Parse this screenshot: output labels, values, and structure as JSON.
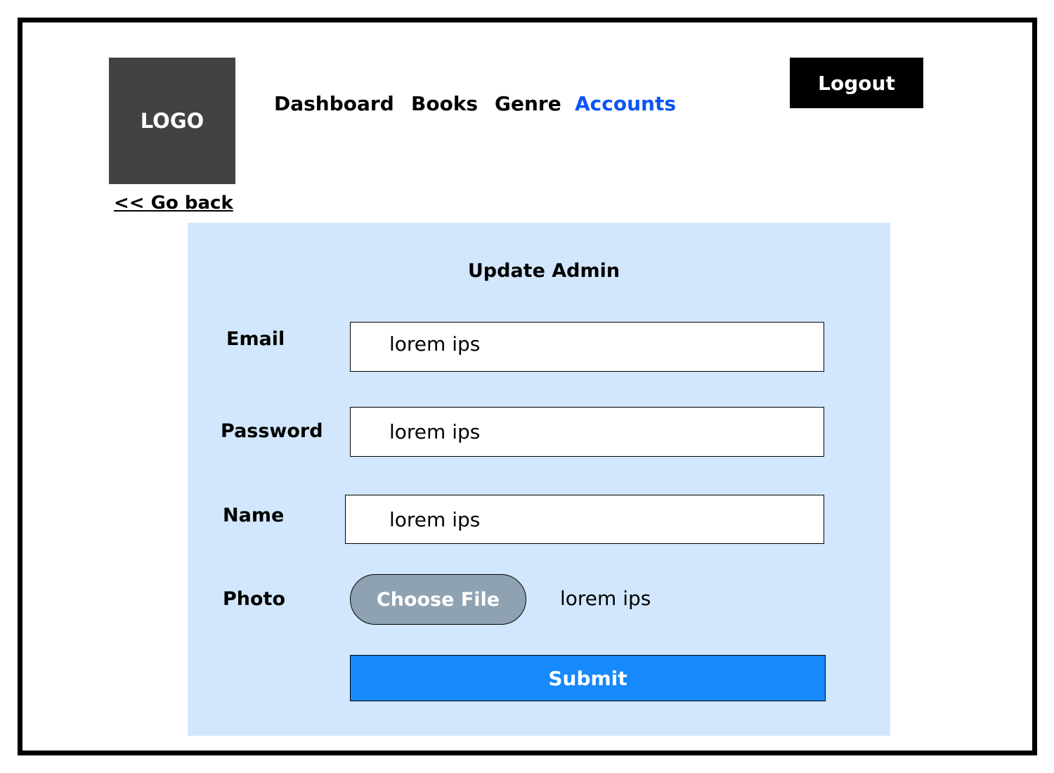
{
  "header": {
    "logo_text": "LOGO",
    "nav": {
      "dashboard": "Dashboard",
      "books": "Books",
      "genre": "Genre",
      "accounts": "Accounts"
    },
    "active_nav": "Accounts",
    "logout_label": "Logout"
  },
  "go_back_label": "<< Go back",
  "form": {
    "title": "Update Admin",
    "email": {
      "label": "Email",
      "value": "lorem ips"
    },
    "password": {
      "label": "Password",
      "value": "lorem ips"
    },
    "name": {
      "label": "Name",
      "value": "lorem ips"
    },
    "photo": {
      "label": "Photo",
      "button_label": "Choose File",
      "file_name": "lorem ips"
    },
    "submit_label": "Submit"
  },
  "colors": {
    "accent": "#0b54f5",
    "panel_background": "#d2e7fd",
    "submit_button": "#1689fc",
    "choose_file_button": "#8fa2b2",
    "logo_background": "#424242"
  }
}
